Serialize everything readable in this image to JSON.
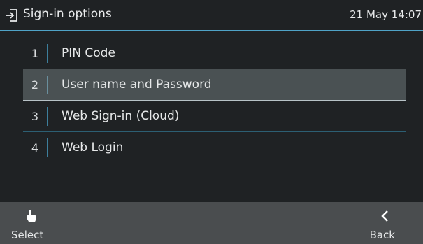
{
  "header": {
    "title": "Sign-in options",
    "clock": "21 May 14:07",
    "icon": "login-icon",
    "accent_color": "#4fa3c7"
  },
  "menu": {
    "items": [
      {
        "number": "1",
        "label": "PIN Code"
      },
      {
        "number": "2",
        "label": "User name and Password",
        "selected": true
      },
      {
        "number": "3",
        "label": "Web Sign-in (Cloud)"
      },
      {
        "number": "4",
        "label": "Web Login"
      }
    ],
    "selected_color": "#4a5153"
  },
  "softkeys": {
    "select_label": "Select",
    "select_icon": "hand-pointer-icon",
    "back_label": "Back",
    "back_icon": "chevron-left-icon"
  }
}
